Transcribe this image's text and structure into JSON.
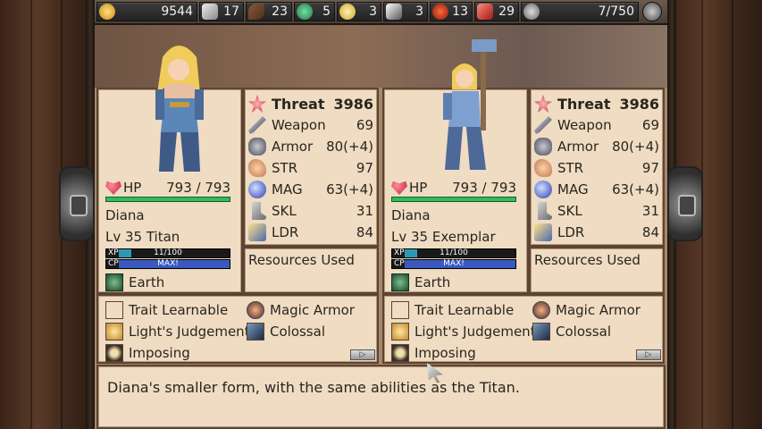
{
  "resources": [
    {
      "name": "gold",
      "value": "9544",
      "icon": "gold-coins-icon"
    },
    {
      "name": "iron",
      "value": "17",
      "icon": "iron-bar-icon"
    },
    {
      "name": "leather",
      "value": "23",
      "icon": "leather-icon"
    },
    {
      "name": "herb",
      "value": "5",
      "icon": "herb-potion-icon"
    },
    {
      "name": "orb",
      "value": "3",
      "icon": "golden-orb-icon"
    },
    {
      "name": "steel",
      "value": "3",
      "icon": "steel-ingot-icon"
    },
    {
      "name": "ruby",
      "value": "13",
      "icon": "ruby-gem-icon"
    },
    {
      "name": "scroll",
      "value": "29",
      "icon": "scroll-icon"
    },
    {
      "name": "stars",
      "value": "7/750",
      "icon": "stars-icon"
    }
  ],
  "units": [
    {
      "name": "Diana",
      "level": "Lv 35 Titan",
      "hp_label": "HP",
      "hp": "793 / 793",
      "xp_label": "XP",
      "xp": "11/100",
      "xp_fraction": 0.11,
      "cp_label": "CP",
      "cp": "MAX!",
      "element": "Earth",
      "stats": {
        "threat_label": "Threat",
        "threat": "3986",
        "weapon_label": "Weapon",
        "weapon": "69",
        "armor_label": "Armor",
        "armor": "80(+4)",
        "str_label": "STR",
        "str": "97",
        "mag_label": "MAG",
        "mag": "63(+4)",
        "skl_label": "SKL",
        "skl": "31",
        "ldr_label": "LDR",
        "ldr": "84"
      },
      "resources_used": "Resources Used",
      "traits": [
        "Trait Learnable",
        "Light's Judgement",
        "Imposing"
      ],
      "traits_right": [
        "Magic Armor",
        "Colossal"
      ]
    },
    {
      "name": "Diana",
      "level": "Lv 35 Exemplar",
      "hp_label": "HP",
      "hp": "793 / 793",
      "xp_label": "XP",
      "xp": "11/100",
      "xp_fraction": 0.11,
      "cp_label": "CP",
      "cp": "MAX!",
      "element": "Earth",
      "stats": {
        "threat_label": "Threat",
        "threat": "3986",
        "weapon_label": "Weapon",
        "weapon": "69",
        "armor_label": "Armor",
        "armor": "80(+4)",
        "str_label": "STR",
        "str": "97",
        "mag_label": "MAG",
        "mag": "63(+4)",
        "skl_label": "SKL",
        "skl": "31",
        "ldr_label": "LDR",
        "ldr": "84"
      },
      "resources_used": "Resources Used",
      "traits": [
        "Trait Learnable",
        "Light's Judgement",
        "Imposing"
      ],
      "traits_right": [
        "Magic Armor",
        "Colossal"
      ]
    }
  ],
  "description": "Diana's smaller form, with the same abilities as the Titan.",
  "next_button": "▷"
}
